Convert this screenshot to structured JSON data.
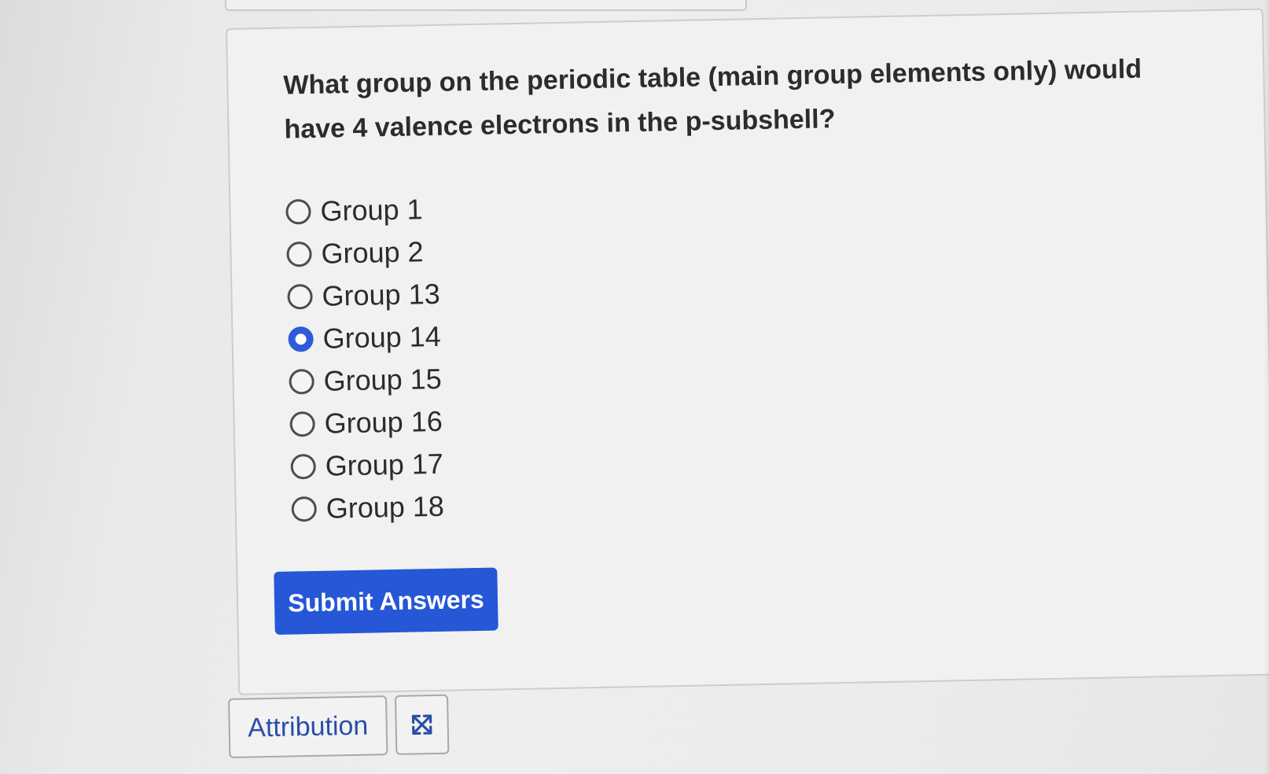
{
  "question": {
    "text": "What group on the periodic table (main group elements only) would have 4 valence electrons in the p-subshell?"
  },
  "options": [
    {
      "label": "Group 1",
      "selected": false
    },
    {
      "label": "Group 2",
      "selected": false
    },
    {
      "label": "Group 13",
      "selected": false
    },
    {
      "label": "Group 14",
      "selected": true
    },
    {
      "label": "Group 15",
      "selected": false
    },
    {
      "label": "Group 16",
      "selected": false
    },
    {
      "label": "Group 17",
      "selected": false
    },
    {
      "label": "Group 18",
      "selected": false
    }
  ],
  "actions": {
    "submit_label": "Submit Answers",
    "attribution_label": "Attribution",
    "expand_icon": "expand-arrows-icon"
  },
  "colors": {
    "accent": "#2557d6",
    "radio_selected": "#2f5bd9",
    "link": "#2a4ea8",
    "text": "#2c2c2c"
  }
}
